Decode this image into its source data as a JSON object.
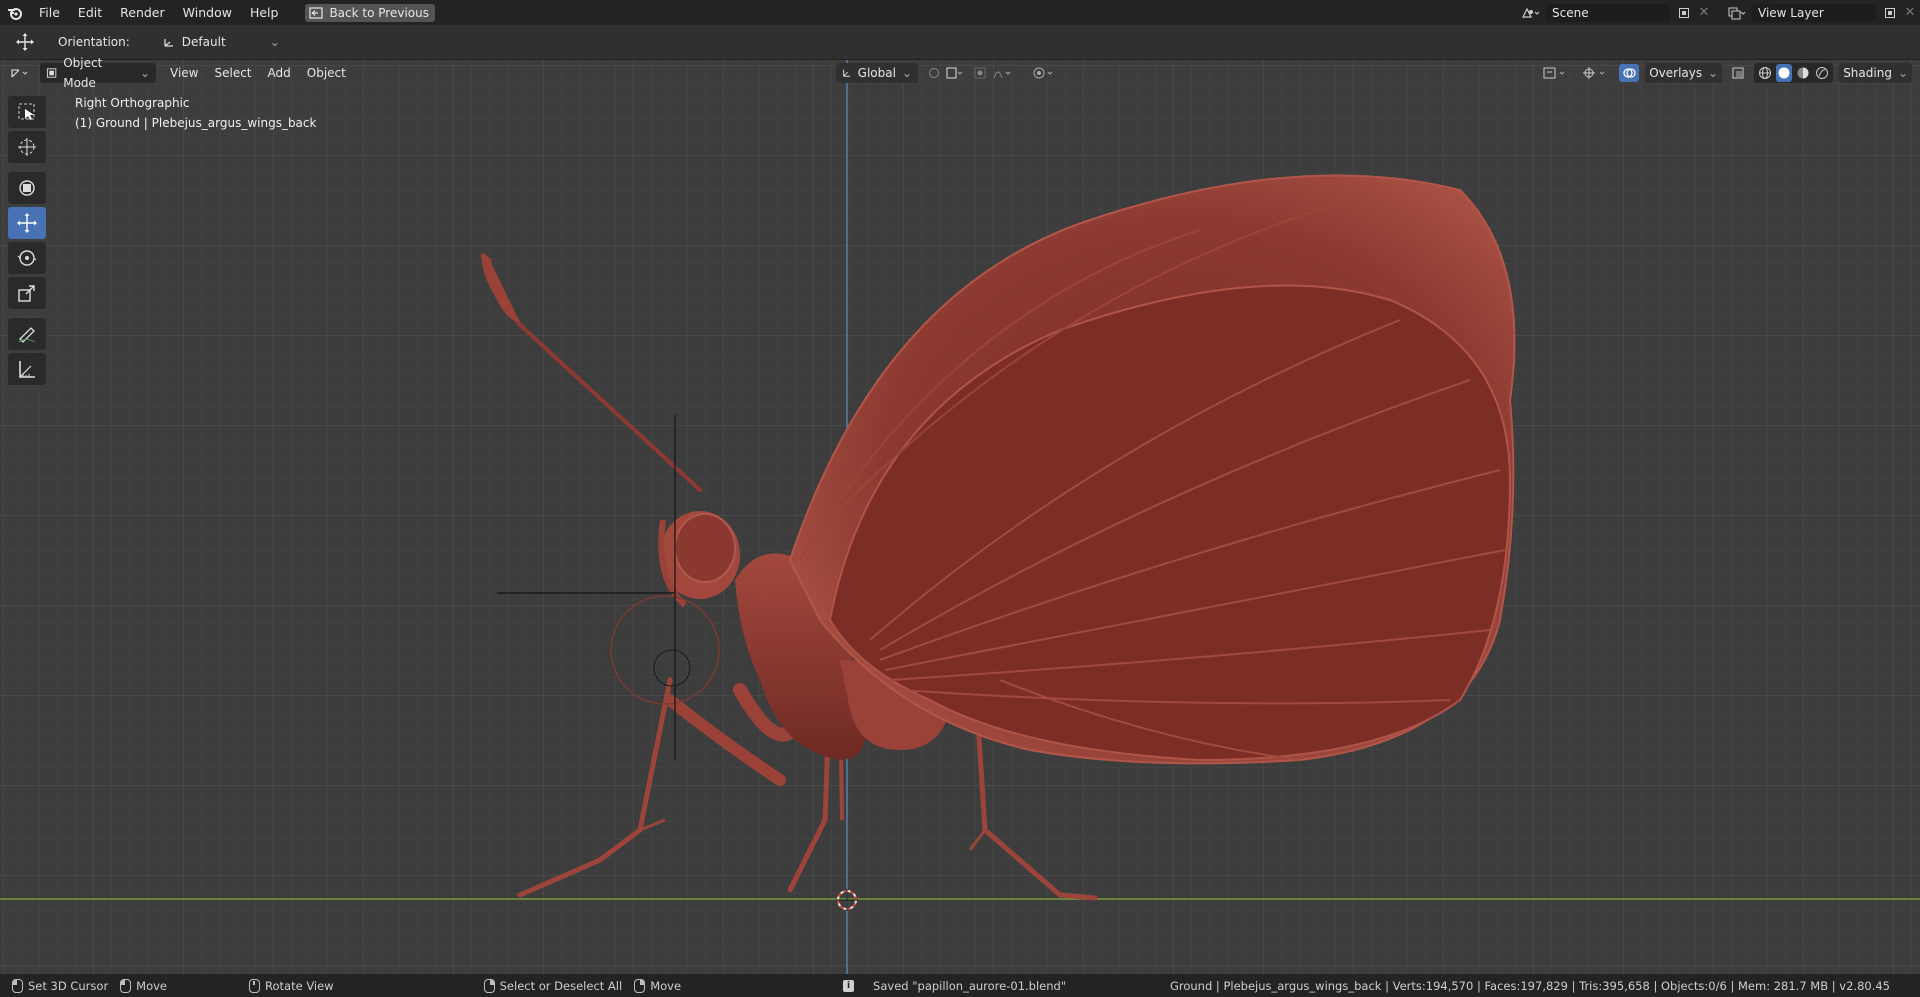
{
  "menubar": {
    "items": [
      "File",
      "Edit",
      "Render",
      "Window",
      "Help"
    ],
    "back_button": "Back to Previous",
    "scene": "Scene",
    "view_layer": "View Layer"
  },
  "tool_header": {
    "orientation_label": "Orientation:",
    "orientation_value": "Default"
  },
  "viewport_header": {
    "mode": "Object Mode",
    "menus": [
      "View",
      "Select",
      "Add",
      "Object"
    ],
    "transform_orientation": "Global",
    "overlays": "Overlays",
    "shading": "Shading"
  },
  "viewport": {
    "view_name": "Right Orthographic",
    "object_info": "(1) Ground | Plebejus_argus_wings_back"
  },
  "statusbar": {
    "left_click": "Set 3D Cursor",
    "left_drag": "Move",
    "middle": "Rotate View",
    "right_click": "Select or Deselect All",
    "right_drag": "Move",
    "message": "Saved \"papillon_aurore-01.blend\"",
    "stats": "Ground | Plebejus_argus_wings_back | Verts:194,570 | Faces:197,829 | Tris:395,658 | Objects:0/6 | Mem: 281.7 MB | v2.80.45"
  },
  "colors": {
    "model": "#8a3a32",
    "accent": "#4772b3",
    "ground_line": "#7a9a3a",
    "z_axis": "#5a7fa8"
  }
}
